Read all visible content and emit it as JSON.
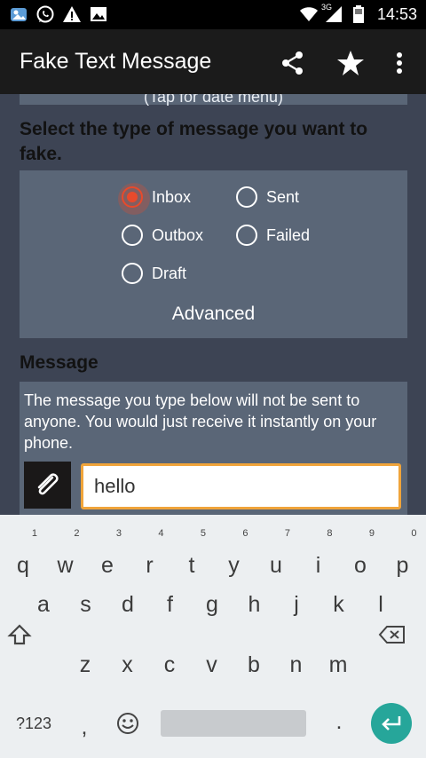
{
  "status_bar": {
    "time": "14:53",
    "network": "3G",
    "icons_left": [
      "gallery-notification-icon",
      "whatsapp-icon",
      "warning-icon",
      "image-icon"
    ],
    "icons_right": [
      "wifi-icon",
      "signal-icon",
      "battery-icon"
    ]
  },
  "app_bar": {
    "title": "Fake Text Message",
    "actions": [
      "share-icon",
      "star-icon",
      "overflow-menu-icon"
    ]
  },
  "content": {
    "prev_hint": "(Tap for date menu)",
    "type_heading": "Select the type of message you want to fake.",
    "message_types": [
      {
        "label": "Inbox",
        "checked": true
      },
      {
        "label": "Sent",
        "checked": false
      },
      {
        "label": "Outbox",
        "checked": false
      },
      {
        "label": "Failed",
        "checked": false
      },
      {
        "label": "Draft",
        "checked": false
      }
    ],
    "advanced_label": "Advanced",
    "message_heading": "Message",
    "message_info": "The message you type below will not be sent to anyone. You would just receive it instantly on your phone.",
    "message_value": "hello"
  },
  "colors": {
    "accent": "#e84a2c",
    "input_border": "#f0a43a",
    "panel": "#5a6677",
    "background": "#3d4454",
    "keyboard_enter": "#26a69a"
  },
  "keyboard": {
    "row1": [
      "q",
      "w",
      "e",
      "r",
      "t",
      "y",
      "u",
      "i",
      "o",
      "p"
    ],
    "row1_hints": [
      "1",
      "2",
      "3",
      "4",
      "5",
      "6",
      "7",
      "8",
      "9",
      "0"
    ],
    "row2": [
      "a",
      "s",
      "d",
      "f",
      "g",
      "h",
      "j",
      "k",
      "l"
    ],
    "row3": [
      "z",
      "x",
      "c",
      "v",
      "b",
      "n",
      "m"
    ],
    "symbols_label": "?123",
    "comma": ",",
    "period": "."
  }
}
